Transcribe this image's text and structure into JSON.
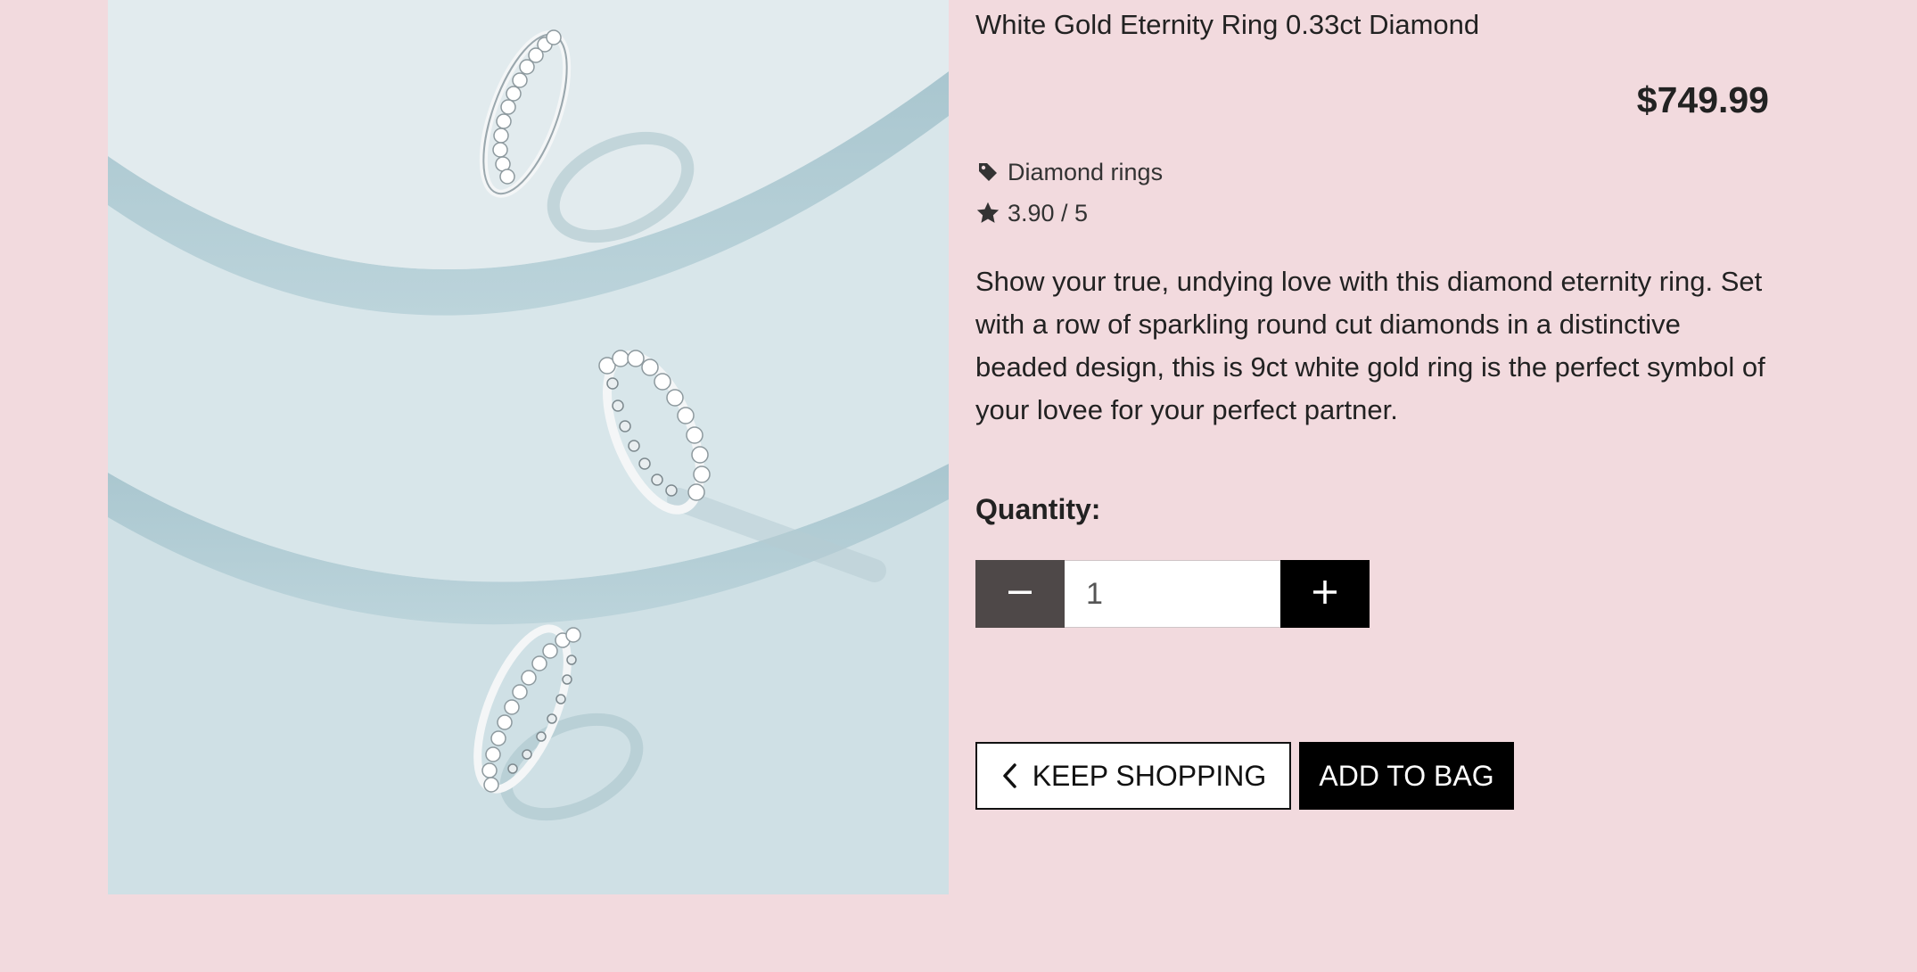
{
  "product": {
    "title": "White Gold Eternity Ring 0.33ct Diamond",
    "price": "$749.99",
    "category": "Diamond rings",
    "rating": "3.90 / 5",
    "description": "Show your true, undying love with this diamond eternity ring. Set with a row of sparkling round cut diamonds in a distinctive beaded design, this is 9ct white gold ring is the perfect symbol of your lovee for your perfect partner."
  },
  "quantity": {
    "label": "Quantity:",
    "value": "1"
  },
  "actions": {
    "keep_shopping_label": "KEEP SHOPPING",
    "add_to_bag_label": "ADD TO BAG"
  },
  "icons": {
    "category": "tag-icon",
    "rating": "star-icon",
    "decrease": "minus-icon",
    "increase": "plus-icon",
    "back": "chevron-left-icon"
  },
  "colors": {
    "page_background": "#f2dade",
    "image_background": "#d4e5ea",
    "minus_button": "#4e4848",
    "plus_button": "#000000",
    "add_to_bag_button": "#000000"
  }
}
